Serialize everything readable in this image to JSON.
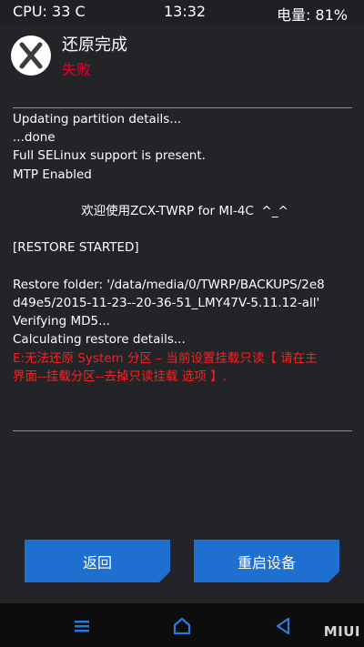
{
  "status_bar": {
    "cpu": "CPU: 33 C",
    "time": "13:32",
    "battery": "电量: 81%"
  },
  "header": {
    "title": "还原完成",
    "subtitle": "失败",
    "logo_icon": "twrp-logo-icon"
  },
  "console": {
    "lines": [
      "Updating partition details...",
      "...done",
      "Full SELinux support is present.",
      "MTP Enabled"
    ],
    "welcome": "欢迎使用ZCX-TWRP for MI-4C  ^_^",
    "restore_started": "[RESTORE STARTED]",
    "restore_folder_1": "Restore folder: '/data/media/0/TWRP/BACKUPS/2e8",
    "restore_folder_2": "d49e5/2015-11-23--20-36-51_LMY47V-5.11.12-all'",
    "verifying": "Verifying MD5...",
    "calculating": "Calculating restore details...",
    "error_1": "E:无法还原 System 分区 – 当前设置挂载只读【 请在主",
    "error_2": "界面--挂载分区--去掉只读挂载 选项 】."
  },
  "buttons": {
    "back": "返回",
    "reboot": "重启设备"
  },
  "navbar": {
    "menu_icon": "menu-icon",
    "home_icon": "home-icon",
    "back_icon": "back-icon",
    "watermark": "MIUI"
  },
  "colors": {
    "accent_button": "#1f6fd0",
    "error": "#ff1f1f",
    "failure": "#e4002b",
    "background": "#222428"
  }
}
